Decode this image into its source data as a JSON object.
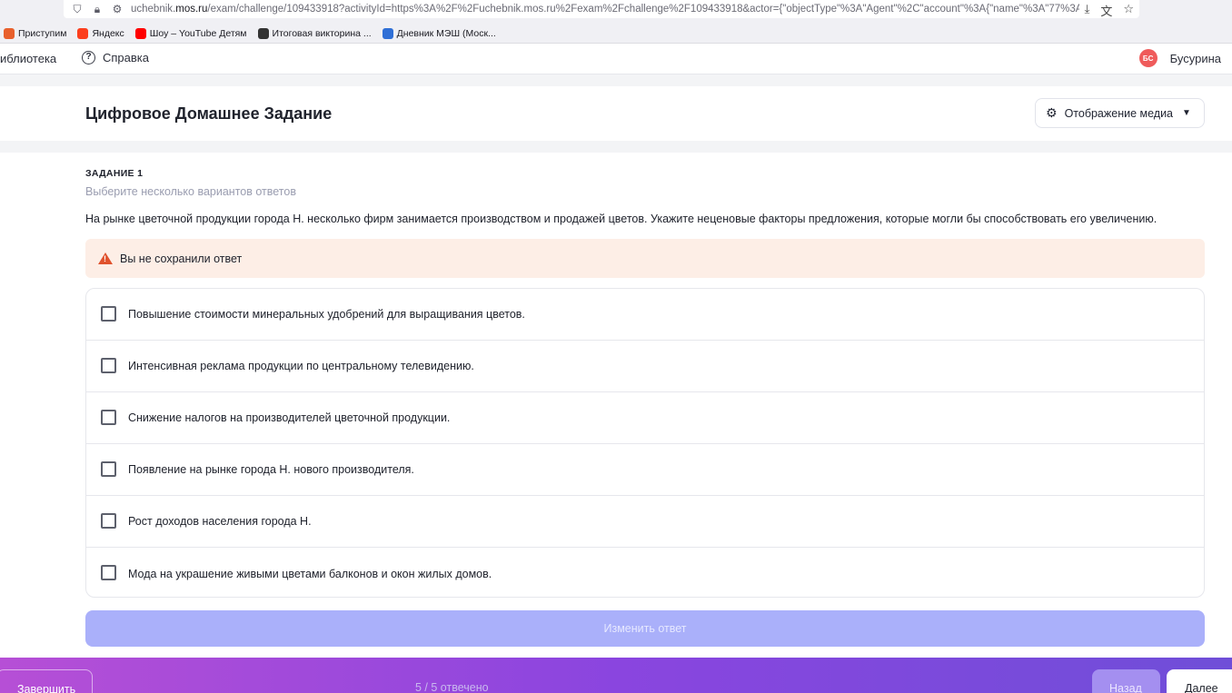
{
  "browser": {
    "url_prefix": "uchebnik.",
    "url_host": "mos.ru",
    "url_rest": "/exam/challenge/109433918?activityId=https%3A%2F%2Fuchebnik.mos.ru%2Fexam%2Fchallenge%2F109433918&actor={\"objectType\"%3A\"Agent\"%2C\"account\"%3A{\"name\"%3A\"77%3Aa",
    "bookmarks": [
      {
        "label": "Приступим",
        "color": "#e8602c"
      },
      {
        "label": "Яндекс",
        "color": "#fc3f1d"
      },
      {
        "label": "Шоу – YouTube Детям",
        "color": "#ff0000"
      },
      {
        "label": "Итоговая викторина ...",
        "color": "#333333"
      },
      {
        "label": "Дневник МЭШ (Моск...",
        "color": "#2f6fd6"
      }
    ]
  },
  "site_header": {
    "nav_library": "иблиотека",
    "nav_help": "Справка",
    "avatar_initials": "БС",
    "user_name": "Бусурина"
  },
  "titlebar": {
    "title": "Цифровое Домашнее Задание",
    "media_label": "Отображение медиа"
  },
  "task": {
    "label": "ЗАДАНИЕ 1",
    "hint": "Выберите несколько вариантов ответов",
    "question": "На рынке цветочной продукции города Н. несколько фирм занимается производством и продажей цветов. Укажите неценовые факторы предложения, которые могли бы способствовать его увеличению.",
    "warning": "Вы не сохранили ответ",
    "options": [
      "Повышение стоимости минеральных удобрений для выращивания цветов.",
      "Интенсивная реклама продукции по центральному телевидению.",
      "Снижение налогов на производителей цветочной продукции.",
      "Появление на рынке города Н. нового производителя.",
      "Рост доходов населения города Н.",
      "Мода на украшение живыми цветами балконов и окон жилых домов."
    ],
    "change_button": "Изменить ответ"
  },
  "bottombar": {
    "finish": "Завершить",
    "progress": "5 / 5 отвечено",
    "back": "Назад",
    "next": "Далее"
  }
}
